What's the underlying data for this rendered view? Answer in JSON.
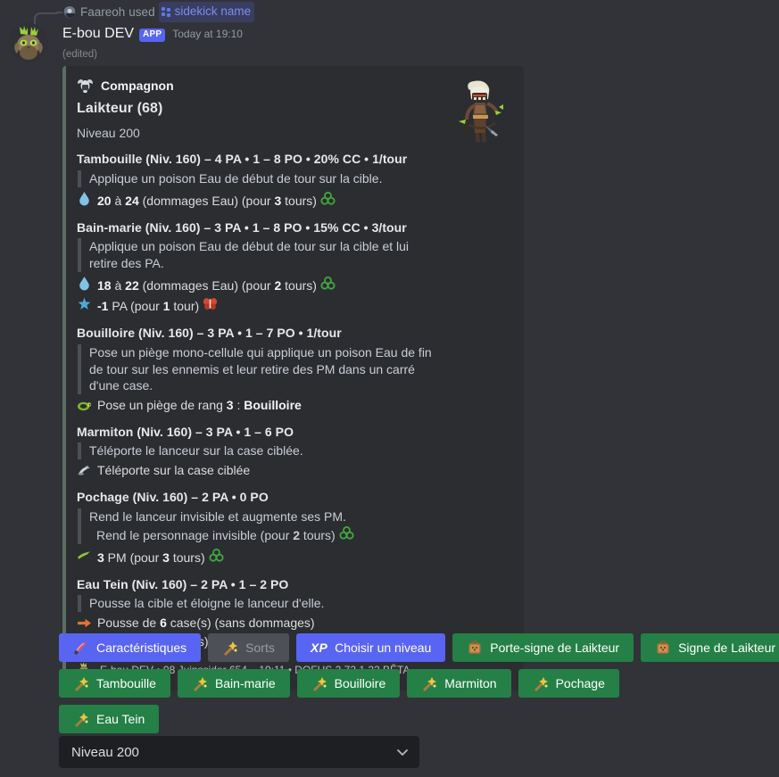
{
  "reply": {
    "user": "Faareoh",
    "used_label": "used",
    "command": "sidekick name",
    "command_icon": "slash-command-icon"
  },
  "message": {
    "author": "E-bou DEV",
    "app_badge": "APP",
    "timestamp": "Today at 19:10",
    "edited": "(edited)",
    "avatar_icon": "owl-creature-avatar"
  },
  "embed": {
    "accent_color": "#5b6e62",
    "background": "#2b2d31",
    "author_name": "Compagnon",
    "author_icon": "helmet-icon",
    "thumbnail_icon": "archer-character-thumbnail",
    "title": "Laikteur (68)",
    "level_line": "Niveau 200",
    "spells": [
      {
        "name": "Tambouille",
        "header": "Tambouille (Niv. 160) – 4 PA • 1 – 8 PO • 20% CC • 1/tour",
        "description": [
          "Applique un poison Eau de début de tour sur la cible."
        ],
        "effects": [
          {
            "icon": "water-drop-icon",
            "text_html": "<b>20</b> à <b>24</b> (dommages Eau) (pour <b>3</b> tours)",
            "suffix_icon": "triskelion-icon"
          }
        ]
      },
      {
        "name": "Bain-marie",
        "header": "Bain-marie (Niv. 160) – 3 PA • 1 – 8 PO • 15% CC • 3/tour",
        "description": [
          "Applique un poison Eau de début de tour sur la cible et lui retire des PA."
        ],
        "effects": [
          {
            "icon": "water-drop-icon",
            "text_html": "<b>18</b> à <b>22</b> (dommages Eau) (pour <b>2</b> tours)",
            "suffix_icon": "triskelion-icon"
          },
          {
            "icon": "pa-star-icon",
            "text_html": "<b>-1</b> PA (pour <b>1</b> tour)",
            "suffix_icon": "red-butterfly-icon"
          }
        ]
      },
      {
        "name": "Bouilloire",
        "header": "Bouilloire (Niv. 160) – 3 PA • 1 – 7 PO • 1/tour",
        "description": [
          "Pose un piège mono-cellule qui applique un poison Eau de fin de tour sur les ennemis et leur retire des PM dans un carré d'une case."
        ],
        "effects": [
          {
            "icon": "trap-icon",
            "text_html": "Pose un piège de rang <b>3</b> : <b>Bouilloire</b>",
            "suffix_icon": ""
          }
        ]
      },
      {
        "name": "Marmiton",
        "header": "Marmiton (Niv. 160) – 3 PA • 1 – 6 PO",
        "description": [
          "Téléporte le lanceur sur la case ciblée."
        ],
        "effects": [
          {
            "icon": "teleport-icon",
            "text_html": "Téléporte sur la case ciblée",
            "suffix_icon": ""
          }
        ]
      },
      {
        "name": "Pochage",
        "header": "Pochage (Niv. 160) – 2 PA • 0 PO",
        "description": [
          "Rend le lanceur invisible et augmente ses PM."
        ],
        "sub_description": "Rend le personnage invisible (pour 2 tours)",
        "sub_description_icon": "triskelion-icon",
        "effects": [
          {
            "icon": "pm-arrow-icon",
            "text_html": "<b>3</b> PM (pour <b>3</b> tours)",
            "suffix_icon": "triskelion-icon"
          }
        ]
      },
      {
        "name": "Eau Tein",
        "header": "Eau Tein (Niv. 160) – 2 PA • 1 – 2 PO",
        "description": [
          "Pousse la cible et éloigne le lanceur d'elle."
        ],
        "effects": [
          {
            "icon": "push-arrow-icon",
            "text_html": "Pousse de <b>6</b> case(s) (sans dommages)",
            "suffix_icon": ""
          },
          {
            "icon": "push-arrow-icon",
            "text_html": "Recule de <b>1</b> case(s)",
            "suffix_icon": ""
          }
        ]
      }
    ],
    "footer_icon": "bot-icon",
    "footer_text": "E-bou DEV • 08 Juinssidor 654 – 19:11 • DOFUS 2.72.1.22 BÊTA"
  },
  "components": {
    "rows": [
      [
        {
          "label": "Caractéristiques",
          "style": "primary",
          "icon": "scroll-icon",
          "name": "characteristics-button"
        },
        {
          "label": "Sorts",
          "style": "secondary",
          "icon": "wand-icon",
          "name": "spells-button"
        },
        {
          "label": "Choisir un niveau",
          "style": "primary",
          "icon": "xp-text",
          "name": "choose-level-button"
        },
        {
          "label": "Porte-signe de Laikteur",
          "style": "success",
          "icon": "bag-icon",
          "name": "sign-bearer-button"
        },
        {
          "label": "Signe de Laikteur",
          "style": "success",
          "icon": "bag-icon",
          "name": "sign-button"
        }
      ],
      [
        {
          "label": "Tambouille",
          "style": "success",
          "icon": "wand-icon",
          "name": "spell-button-tambouille"
        },
        {
          "label": "Bain-marie",
          "style": "success",
          "icon": "wand-icon",
          "name": "spell-button-bain-marie"
        },
        {
          "label": "Bouilloire",
          "style": "success",
          "icon": "wand-icon",
          "name": "spell-button-bouilloire"
        },
        {
          "label": "Marmiton",
          "style": "success",
          "icon": "wand-icon",
          "name": "spell-button-marmiton"
        },
        {
          "label": "Pochage",
          "style": "success",
          "icon": "wand-icon",
          "name": "spell-button-pochage"
        }
      ],
      [
        {
          "label": "Eau Tein",
          "style": "success",
          "icon": "wand-icon",
          "name": "spell-button-eau-tein"
        }
      ]
    ],
    "select": {
      "value": "Niveau 200",
      "chevron_icon": "chevron-down-icon"
    }
  }
}
